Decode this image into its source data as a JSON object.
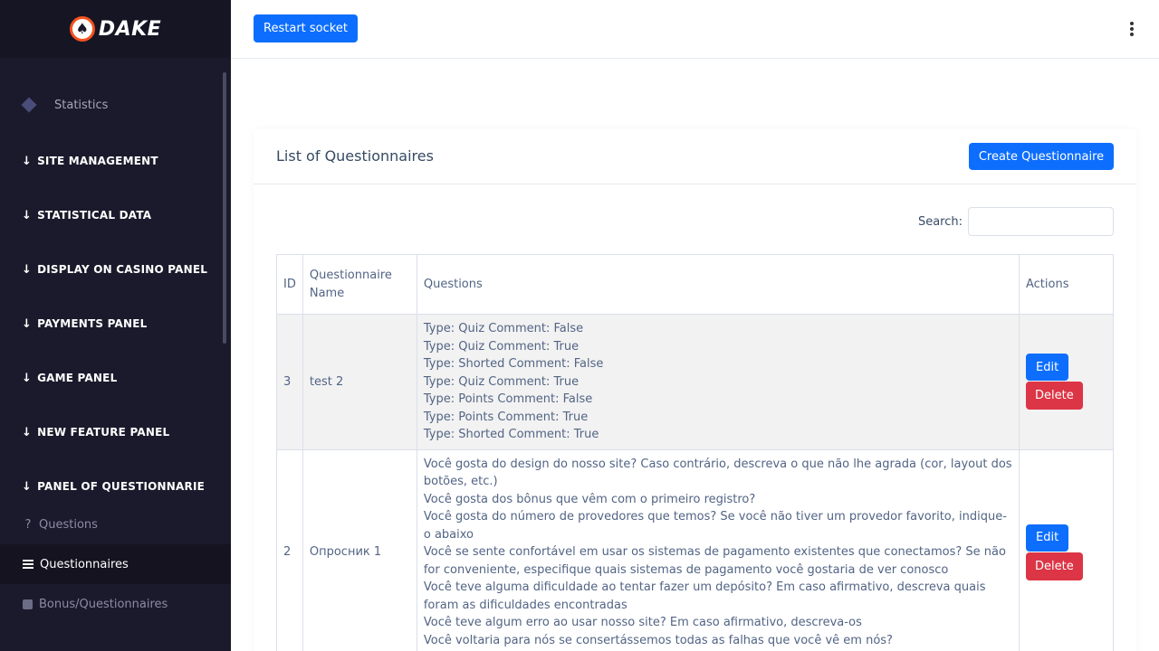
{
  "brand": {
    "logo_text": "DAKE",
    "accent": "#f4511e"
  },
  "sidebar": {
    "statistics_label": "Statistics",
    "sections": [
      "SITE MANAGEMENT",
      "STATISTICAL DATA",
      "DISPLAY ON CASINO PANEL",
      "PAYMENTS PANEL",
      "GAME PANEL",
      "NEW FEATURE PANEL",
      "PANEL OF QUESTIONNARIE"
    ],
    "subitems": {
      "questions": "Questions",
      "questionnaires": "Questionnaires",
      "bonus": "Bonus/Questionnaires"
    }
  },
  "header": {
    "restart_label": "Restart socket"
  },
  "card": {
    "title": "List of Questionnaires",
    "create_label": "Create Questionnaire",
    "search_label": "Search:",
    "search_value": ""
  },
  "table": {
    "headers": {
      "id": "ID",
      "name": "Questionnaire Name",
      "questions": "Questions",
      "actions": "Actions"
    },
    "rows": [
      {
        "id": "3",
        "name": "test 2",
        "questions": [
          "Type: Quiz Comment: False",
          "Type: Quiz Comment: True",
          "Type: Shorted Comment: False",
          "Type: Quiz Comment: True",
          "Type: Points Comment: False",
          "Type: Points Comment: True",
          "Type: Shorted Comment: True"
        ],
        "edit": "Edit",
        "delete": "Delete"
      },
      {
        "id": "2",
        "name": "Опросник 1",
        "questions": [
          "Você gosta do design do nosso site? Caso contrário, descreva o que não lhe agrada (cor, layout dos botões, etc.)",
          "Você gosta dos bônus que vêm com o primeiro registro?",
          "Você gosta do número de provedores que temos? Se você não tiver um provedor favorito, indique-o abaixo",
          "Você se sente confortável em usar os sistemas de pagamento existentes que conectamos? Se não for conveniente, especifique quais sistemas de pagamento você gostaria de ver conosco",
          "Você teve alguma dificuldade ao tentar fazer um depósito? Em caso afirmativo, descreva quais foram as dificuldades encontradas",
          "Você teve algum erro ao usar nosso site? Em caso afirmativo, descreva-os",
          "Você voltaria para nós se consertássemos todas as falhas que você vê em nós?"
        ],
        "edit": "Edit",
        "delete": "Delete"
      }
    ]
  }
}
